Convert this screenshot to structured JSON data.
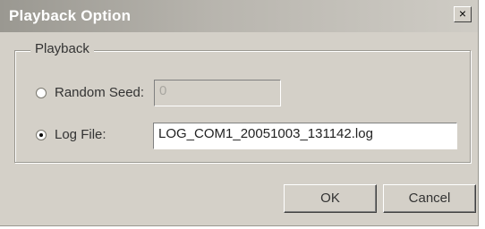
{
  "window": {
    "title": "Playback Option",
    "close_label": "×"
  },
  "group": {
    "label": "Playback"
  },
  "random_seed": {
    "label": "Random Seed:",
    "value": "0",
    "selected": false,
    "enabled": false
  },
  "log_file": {
    "label": "Log File:",
    "value": "LOG_COM1_20051003_131142.log",
    "selected": true
  },
  "buttons": {
    "ok": "OK",
    "cancel": "Cancel"
  },
  "colors": {
    "dialog_bg": "#d4d0c8",
    "title_text": "#ffffff"
  },
  "icons": {
    "close": "close-icon",
    "radio": "radio-button-icon"
  }
}
